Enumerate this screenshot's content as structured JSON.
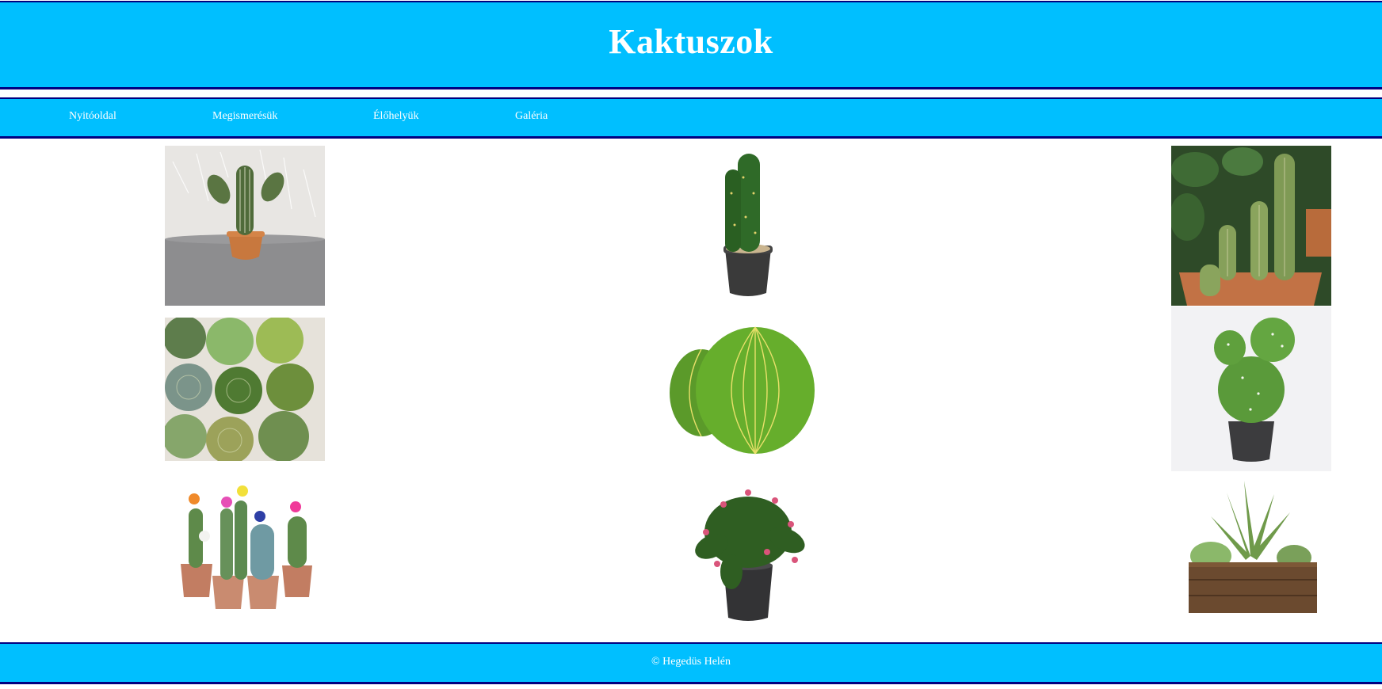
{
  "header": {
    "title": "Kaktuszok"
  },
  "nav": {
    "items": [
      {
        "label": "Nyitóoldal"
      },
      {
        "label": "Megismerésük"
      },
      {
        "label": "Élőhelyük"
      },
      {
        "label": "Galéria"
      }
    ]
  },
  "gallery": {
    "images": [
      {
        "icon": "cactus-with-arms-in-clay-pot"
      },
      {
        "icon": "tall-cactus-in-black-pot"
      },
      {
        "icon": "cacti-in-planter-with-foliage"
      },
      {
        "icon": "assorted-succulents-top-view"
      },
      {
        "icon": "golden-barrel-cactus"
      },
      {
        "icon": "bunny-ear-cactus-in-grey-pot"
      },
      {
        "icon": "flowering-cacti-in-pots"
      },
      {
        "icon": "christmas-cactus-in-black-pot"
      },
      {
        "icon": "succulents-in-wooden-box"
      }
    ]
  },
  "footer": {
    "text": "© Hegedüs Helén"
  },
  "colors": {
    "band": "#00bfff",
    "border": "#000080",
    "text": "#ffffff"
  }
}
